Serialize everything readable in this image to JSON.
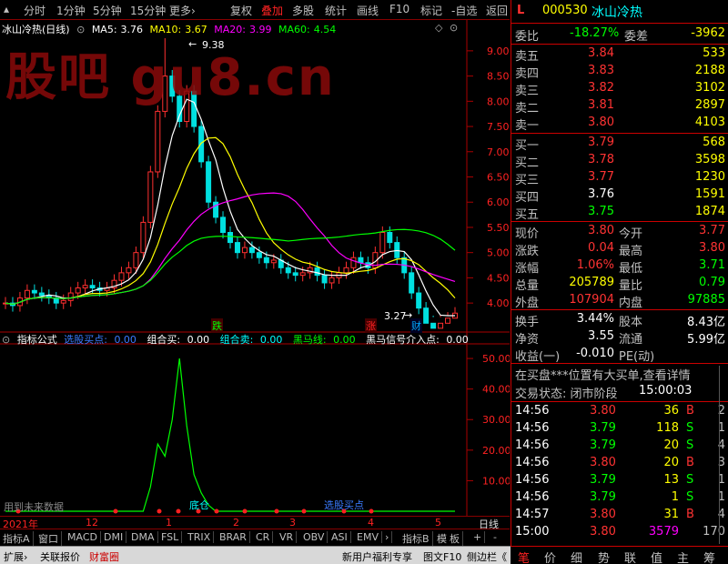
{
  "watermark": "股吧 gu8.cn",
  "toolbar": {
    "left_items": [
      "分时",
      "1分钟",
      "5分钟",
      "15分钟",
      "更多›"
    ],
    "right_items": [
      "复权",
      "叠加",
      "多股",
      "统计",
      "画线",
      "F10",
      "标记",
      "-自选",
      "返回"
    ]
  },
  "main_chart": {
    "stock_label": "冰山冷热(日线)",
    "ma": [
      {
        "name": "MA5:",
        "value": "3.76",
        "color": "#ffffff"
      },
      {
        "name": "MA10:",
        "value": "3.67",
        "color": "#ffff00"
      },
      {
        "name": "MA20:",
        "value": "3.99",
        "color": "#ff00ff"
      },
      {
        "name": "MA60:",
        "value": "4.54",
        "color": "#00ff00"
      }
    ],
    "high_label": "9.38",
    "low_label": "3.27",
    "markers": [
      {
        "text": "跌",
        "color": "#00ff00"
      },
      {
        "text": "涨",
        "color": "#ff0000"
      },
      {
        "text": "财",
        "color": "#00a0ff"
      }
    ]
  },
  "chart_data": [
    {
      "type": "candlestick",
      "title": "冰山冷热(日线)",
      "y_ticks": [
        "9.00",
        "8.50",
        "8.00",
        "7.50",
        "7.00",
        "6.50",
        "6.00",
        "5.50",
        "5.00",
        "4.50",
        "4.00"
      ],
      "ylim": [
        3.75,
        9.25
      ],
      "max_price": 9.38,
      "min_price": 3.27,
      "close_path": [
        4.0,
        3.95,
        4.1,
        4.25,
        4.2,
        4.15,
        4.1,
        4.0,
        4.05,
        4.2,
        4.3,
        4.35,
        4.3,
        4.25,
        4.3,
        4.45,
        4.6,
        4.7,
        5.0,
        5.6,
        6.6,
        7.8,
        8.5,
        8.1,
        7.6,
        8.2,
        7.5,
        6.8,
        6.0,
        5.7,
        5.4,
        5.2,
        5.0,
        5.1,
        5.0,
        4.9,
        4.8,
        4.85,
        4.7,
        4.6,
        4.55,
        4.6,
        4.7,
        4.55,
        4.4,
        4.5,
        4.6,
        4.7,
        4.9,
        4.8,
        4.7,
        5.0,
        5.4,
        5.2,
        4.9,
        4.6,
        4.2,
        3.9,
        3.6,
        3.5,
        3.6,
        3.7,
        3.8
      ],
      "ma_series": [
        {
          "name": "MA5",
          "value": 3.76
        },
        {
          "name": "MA10",
          "value": 3.67
        },
        {
          "name": "MA20",
          "value": 3.99
        },
        {
          "name": "MA60",
          "value": 4.54
        }
      ]
    },
    {
      "type": "line",
      "title": "指标公式",
      "y_ticks": [
        "50.00",
        "40.00",
        "30.00",
        "20.00",
        "10.00"
      ],
      "ylim": [
        0,
        53
      ],
      "series": [
        {
          "name": "组合卖",
          "values": [
            0,
            0,
            0,
            0,
            0,
            0,
            0,
            0,
            0,
            0,
            0,
            0,
            0,
            0,
            0,
            0,
            0,
            0,
            0,
            0,
            8,
            22,
            18,
            30,
            50,
            28,
            12,
            6,
            2,
            0,
            0,
            0,
            0,
            0,
            0,
            0,
            0,
            0,
            0,
            0,
            0,
            0,
            0,
            0,
            0,
            0,
            0,
            0,
            0,
            0,
            0,
            0,
            0,
            0,
            0,
            0,
            0,
            0,
            0,
            0,
            0,
            0,
            0
          ]
        }
      ],
      "legend": [
        "选股买点: 0.00",
        "组合买: 0.00",
        "组合卖: 0.00",
        "黑马线: 0.00",
        "黑马信号介入点: 0.00"
      ]
    }
  ],
  "indicator_panel": {
    "title": "指标公式",
    "legend": [
      {
        "label": "选股买点:",
        "value": "0.00",
        "color": "#3a7bff"
      },
      {
        "label": "组合买:",
        "value": "0.00",
        "color": "#ffffff"
      },
      {
        "label": "组合卖:",
        "value": "0.00",
        "color": "#00ffff"
      },
      {
        "label": "黑马线:",
        "value": "0.00",
        "color": "#00ff00"
      },
      {
        "label": "黑马信号介入点:",
        "value": "0.00",
        "color": "#ffffff"
      }
    ],
    "future_data_note": "用到未来数据",
    "chart_labels": [
      "底仓",
      "选股买点"
    ]
  },
  "x_axis": {
    "labels": [
      "2021年",
      "12",
      "1",
      "2",
      "3",
      "4",
      "5"
    ],
    "right_label": "日线"
  },
  "indicator_tabs": [
    "指标A",
    "窗口",
    "MACD",
    "DMI",
    "DMA",
    "FSL",
    "TRIX",
    "BRAR",
    "CR",
    "VR",
    "OBV",
    "ASI",
    "EMV",
    "›",
    "指标B",
    "模",
    "板",
    "+",
    "-"
  ],
  "bottom_bar": {
    "left": [
      "扩展›",
      "关联报价",
      "财富圈"
    ],
    "right": [
      "新用户福利专享",
      "图文F10",
      "侧边栏《"
    ]
  },
  "quote": {
    "flag": "L",
    "code": "000530",
    "name": "冰山冷热",
    "weibi_label": "委比",
    "weibi": "-18.27%",
    "weicha_label": "委差",
    "weicha": "-3962",
    "asks": [
      {
        "label": "卖五",
        "price": "3.84",
        "vol": "533"
      },
      {
        "label": "卖四",
        "price": "3.83",
        "vol": "2188"
      },
      {
        "label": "卖三",
        "price": "3.82",
        "vol": "3102"
      },
      {
        "label": "卖二",
        "price": "3.81",
        "vol": "2897"
      },
      {
        "label": "卖一",
        "price": "3.80",
        "vol": "4103"
      }
    ],
    "bids": [
      {
        "label": "买一",
        "price": "3.79",
        "vol": "568"
      },
      {
        "label": "买二",
        "price": "3.78",
        "vol": "3598"
      },
      {
        "label": "买三",
        "price": "3.77",
        "vol": "1230"
      },
      {
        "label": "买四",
        "price": "3.76",
        "vol": "1591"
      },
      {
        "label": "买五",
        "price": "3.75",
        "vol": "1874"
      }
    ],
    "stats": [
      {
        "l1": "现价",
        "v1": "3.80",
        "c1": "#ff3333",
        "l2": "今开",
        "v2": "3.77",
        "c2": "#ff3333"
      },
      {
        "l1": "涨跌",
        "v1": "0.04",
        "c1": "#ff3333",
        "l2": "最高",
        "v2": "3.80",
        "c2": "#ff3333"
      },
      {
        "l1": "涨幅",
        "v1": "1.06%",
        "c1": "#ff3333",
        "l2": "最低",
        "v2": "3.71",
        "c2": "#00ff00"
      },
      {
        "l1": "总量",
        "v1": "205789",
        "c1": "#ffff00",
        "l2": "量比",
        "v2": "0.79",
        "c2": "#00ff00"
      },
      {
        "l1": "外盘",
        "v1": "107904",
        "c1": "#ff3333",
        "l2": "内盘",
        "v2": "97885",
        "c2": "#00ff00"
      }
    ],
    "fund": [
      {
        "l1": "换手",
        "v1": "3.44%",
        "l2": "股本",
        "v2": "8.43亿"
      },
      {
        "l1": "净资",
        "v1": "3.55",
        "l2": "流通",
        "v2": "5.99亿"
      },
      {
        "l1": "收益(一)",
        "v1": "-0.010",
        "l2": "PE(动)",
        "v2": ""
      }
    ],
    "notice": "在买盘***位置有大买单,查看详情",
    "status": "交易状态: 闭市阶段",
    "status_time": "15:00:03",
    "trades": [
      {
        "time": "14:56",
        "price": "3.80",
        "vol": "36",
        "side": "B",
        "n": "2"
      },
      {
        "time": "14:56",
        "price": "3.79",
        "vol": "118",
        "side": "S",
        "n": "1"
      },
      {
        "time": "14:56",
        "price": "3.79",
        "vol": "20",
        "side": "S",
        "n": "4"
      },
      {
        "time": "14:56",
        "price": "3.80",
        "vol": "20",
        "side": "B",
        "n": "3"
      },
      {
        "time": "14:56",
        "price": "3.79",
        "vol": "13",
        "side": "S",
        "n": "1"
      },
      {
        "time": "14:56",
        "price": "3.79",
        "vol": "1",
        "side": "S",
        "n": "1"
      },
      {
        "time": "14:57",
        "price": "3.80",
        "vol": "31",
        "side": "B",
        "n": "4"
      },
      {
        "time": "15:00",
        "price": "3.80",
        "vol": "3579",
        "side": "",
        "n": "170"
      }
    ],
    "tabs": [
      "笔",
      "价",
      "细",
      "势",
      "联",
      "值",
      "主",
      "筹"
    ]
  }
}
